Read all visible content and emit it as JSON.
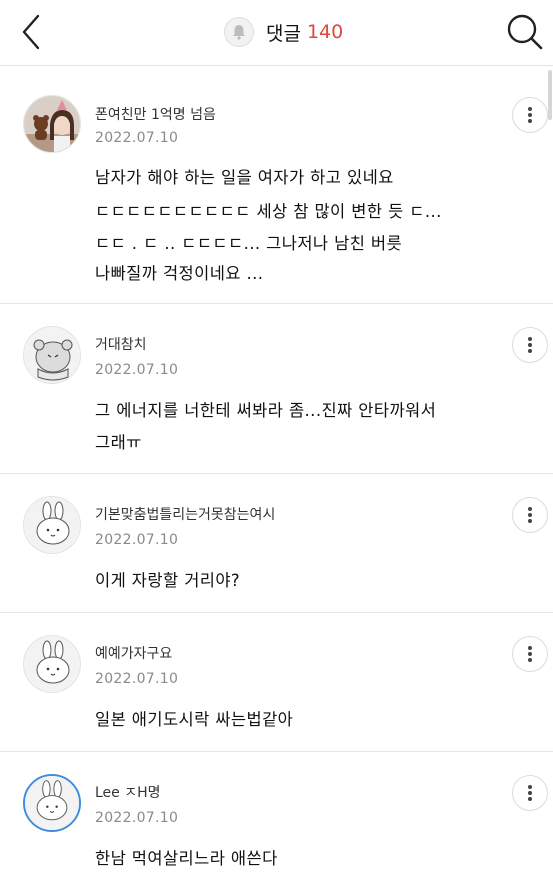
{
  "header": {
    "title": "댓글",
    "count": "140",
    "count_color": "#e0463a",
    "back_icon": "chevron-left-icon",
    "bell_icon": "bell-icon",
    "search_icon": "search-icon"
  },
  "comments": [
    {
      "author": "폰여친만 1억명 넘음",
      "date": "2022.07.10",
      "lines": [
        "남자가 해야 하는 일을 여자가 하고 있네요",
        "ㄷㄷㄷㄷㄷㄷㄷㄷㄷㄷ 세상 참 많이 변한 듯 ㄷ...",
        "ㄷㄷ . ㄷ .. ㄷㄷㄷㄷ... 그나저나 남친 버릇",
        "나빠질까 걱정이네요 ..."
      ]
    },
    {
      "author": "거대참치",
      "date": "2022.07.10",
      "lines": [
        "그 에너지를 너한테 써봐라 좀...진짜 안타까워서",
        "그래ㅠ"
      ]
    },
    {
      "author": "기본맞춤법틀리는거못참는여시",
      "date": "2022.07.10",
      "lines": [
        "이게 자랑할 거리야?"
      ]
    },
    {
      "author": "예예가자구요",
      "date": "2022.07.10",
      "lines": [
        "일본 애기도시락 싸는법같아"
      ]
    },
    {
      "author": "Lee ㅈH명",
      "date": "2022.07.10",
      "lines": [
        "한남 먹여살리느라 애쓴다"
      ]
    }
  ]
}
